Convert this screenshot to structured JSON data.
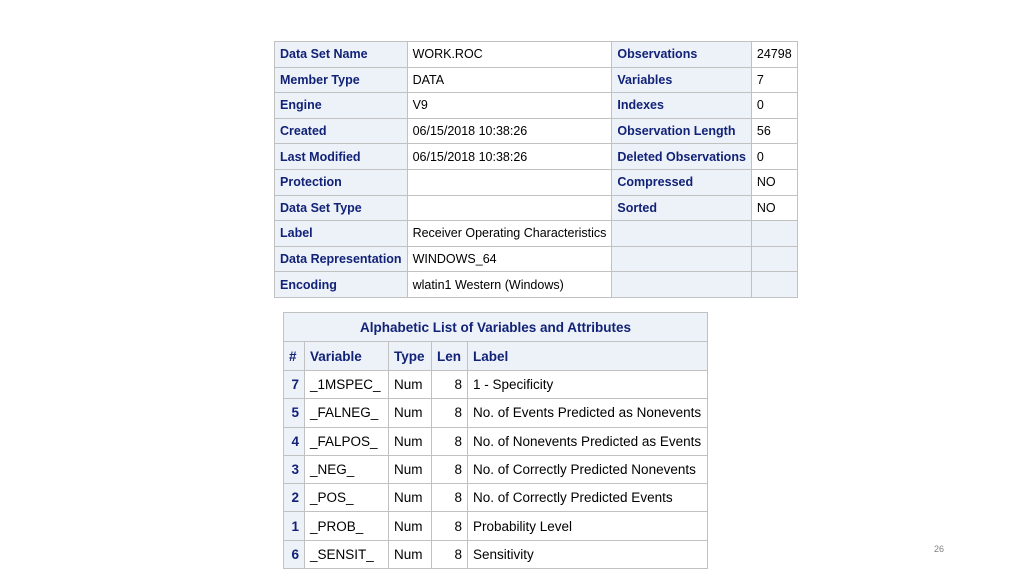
{
  "attributes": [
    {
      "label": "Data Set Name",
      "value": "WORK.ROC",
      "label2": "Observations",
      "value2": "24798"
    },
    {
      "label": "Member Type",
      "value": "DATA",
      "label2": "Variables",
      "value2": "7"
    },
    {
      "label": "Engine",
      "value": "V9",
      "label2": "Indexes",
      "value2": "0"
    },
    {
      "label": "Created",
      "value": "06/15/2018 10:38:26",
      "label2": "Observation Length",
      "value2": "56"
    },
    {
      "label": "Last Modified",
      "value": "06/15/2018 10:38:26",
      "label2": "Deleted Observations",
      "value2": "0"
    },
    {
      "label": "Protection",
      "value": "",
      "label2": "Compressed",
      "value2": "NO"
    },
    {
      "label": "Data Set Type",
      "value": "",
      "label2": "Sorted",
      "value2": "NO"
    },
    {
      "label": "Label",
      "value": "Receiver Operating Characteristics",
      "label2": "",
      "value2": ""
    },
    {
      "label": "Data Representation",
      "value": "WINDOWS_64",
      "label2": "",
      "value2": ""
    },
    {
      "label": "Encoding",
      "value": "wlatin1  Western (Windows)",
      "label2": "",
      "value2": ""
    }
  ],
  "variables_table": {
    "title": "Alphabetic List of Variables and Attributes",
    "columns": [
      "#",
      "Variable",
      "Type",
      "Len",
      "Label"
    ],
    "rows": [
      {
        "num": "7",
        "variable": "_1MSPEC_",
        "type": "Num",
        "len": "8",
        "label": "1 - Specificity"
      },
      {
        "num": "5",
        "variable": "_FALNEG_",
        "type": "Num",
        "len": "8",
        "label": "No. of Events Predicted as Nonevents"
      },
      {
        "num": "4",
        "variable": "_FALPOS_",
        "type": "Num",
        "len": "8",
        "label": "No. of Nonevents Predicted as Events"
      },
      {
        "num": "3",
        "variable": "_NEG_",
        "type": "Num",
        "len": "8",
        "label": "No. of Correctly Predicted Nonevents"
      },
      {
        "num": "2",
        "variable": "_POS_",
        "type": "Num",
        "len": "8",
        "label": "No. of Correctly Predicted Events"
      },
      {
        "num": "1",
        "variable": "_PROB_",
        "type": "Num",
        "len": "8",
        "label": "Probability Level"
      },
      {
        "num": "6",
        "variable": "_SENSIT_",
        "type": "Num",
        "len": "8",
        "label": "Sensitivity"
      }
    ]
  },
  "page_number": "26"
}
